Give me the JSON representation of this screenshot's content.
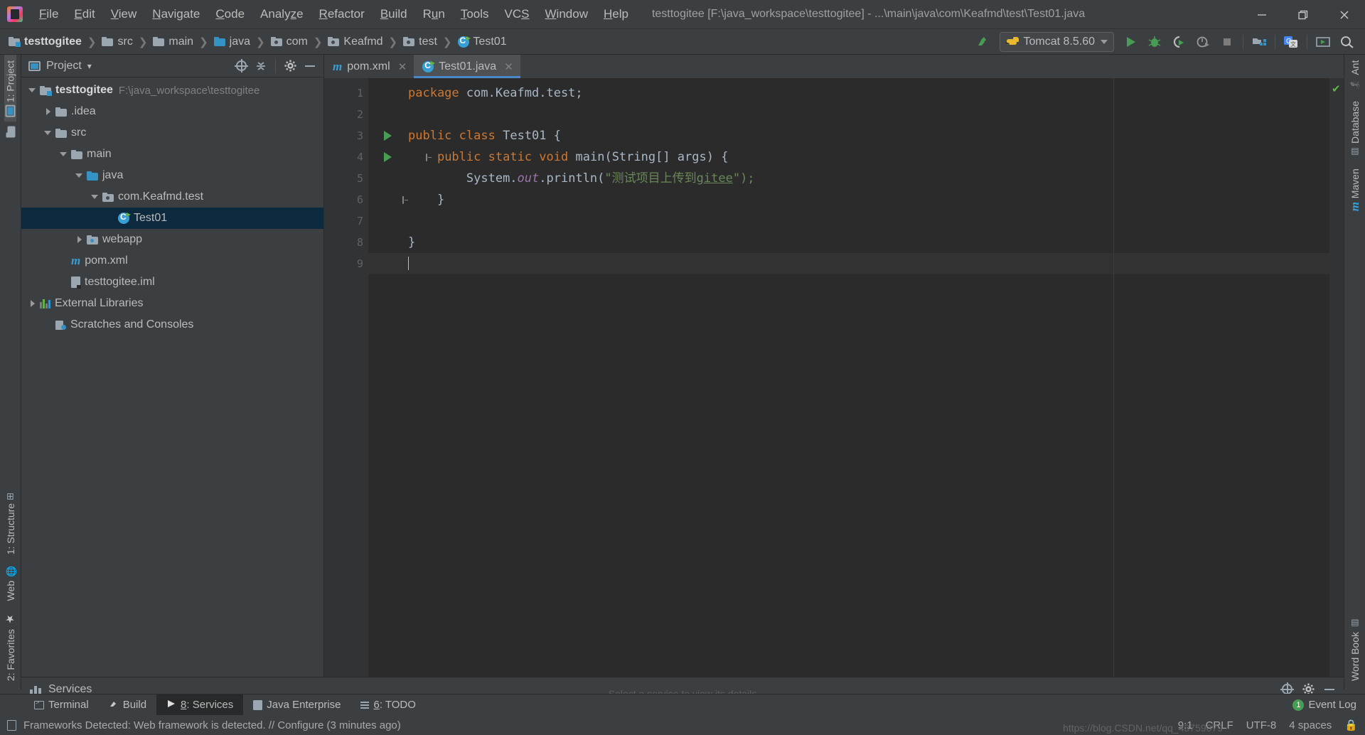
{
  "window": {
    "title": "testtogitee [F:\\java_workspace\\testtogitee] - ...\\main\\java\\com\\Keafmd\\test\\Test01.java",
    "minimize": "—",
    "maximize": "❐",
    "close": "✕"
  },
  "menu": [
    {
      "label": "File"
    },
    {
      "label": "Edit"
    },
    {
      "label": "View"
    },
    {
      "label": "Navigate"
    },
    {
      "label": "Code"
    },
    {
      "label": "Analyze"
    },
    {
      "label": "Refactor"
    },
    {
      "label": "Build"
    },
    {
      "label": "Run"
    },
    {
      "label": "Tools"
    },
    {
      "label": "VCS"
    },
    {
      "label": "Window"
    },
    {
      "label": "Help"
    }
  ],
  "breadcrumb": [
    {
      "label": "testtogitee",
      "icon": "project-folder-icon"
    },
    {
      "label": "src",
      "icon": "folder-icon"
    },
    {
      "label": "main",
      "icon": "folder-icon"
    },
    {
      "label": "java",
      "icon": "source-folder-icon"
    },
    {
      "label": "com",
      "icon": "package-icon"
    },
    {
      "label": "Keafmd",
      "icon": "package-icon"
    },
    {
      "label": "test",
      "icon": "package-icon"
    },
    {
      "label": "Test01",
      "icon": "java-class-icon"
    }
  ],
  "toolbar": {
    "build_label": "build-icon",
    "run_config": "Tomcat 8.5.60",
    "run_config_icon": "tomcat-icon",
    "actions": [
      "run-icon",
      "debug-icon",
      "run-coverage-icon",
      "profile-icon",
      "stop-icon",
      "project-structure-icon",
      "translate-icon",
      "open-in-browser-icon",
      "search-everywhere-icon"
    ]
  },
  "left_strip": [
    {
      "label": "1: Project",
      "active": true
    },
    {
      "label": "2: Favorites",
      "active": false
    },
    {
      "label": "Web",
      "active": false
    },
    {
      "label": "1: Structure",
      "active": false
    }
  ],
  "right_strip": [
    {
      "label": "Ant"
    },
    {
      "label": "Database"
    },
    {
      "label": "Maven"
    },
    {
      "label": "Word Book"
    }
  ],
  "project_panel": {
    "title": "Project",
    "title_caret": "▾",
    "tools": [
      "locate-icon",
      "collapse-all-icon",
      "settings-gear-icon",
      "hide-icon"
    ],
    "tree": [
      {
        "label": "testtogitee",
        "path": "F:\\java_workspace\\testtogitee",
        "depth": 0,
        "arrow": "down",
        "icon": "project-folder-icon",
        "bold": true,
        "selected": false
      },
      {
        "label": ".idea",
        "path": "",
        "depth": 1,
        "arrow": "right",
        "icon": "folder-icon",
        "bold": false,
        "selected": false
      },
      {
        "label": "src",
        "path": "",
        "depth": 1,
        "arrow": "down",
        "icon": "folder-icon",
        "bold": false,
        "selected": false
      },
      {
        "label": "main",
        "path": "",
        "depth": 2,
        "arrow": "down",
        "icon": "folder-icon",
        "bold": false,
        "selected": false
      },
      {
        "label": "java",
        "path": "",
        "depth": 3,
        "arrow": "down",
        "icon": "source-folder-icon",
        "bold": false,
        "selected": false
      },
      {
        "label": "com.Keafmd.test",
        "path": "",
        "depth": 4,
        "arrow": "down",
        "icon": "package-icon",
        "bold": false,
        "selected": false
      },
      {
        "label": "Test01",
        "path": "",
        "depth": 5,
        "arrow": "none",
        "icon": "java-class-icon",
        "bold": false,
        "selected": true
      },
      {
        "label": "webapp",
        "path": "",
        "depth": 3,
        "arrow": "right",
        "icon": "webapp-folder-icon",
        "bold": false,
        "selected": false
      },
      {
        "label": "pom.xml",
        "path": "",
        "depth": 2,
        "arrow": "none",
        "icon": "maven-icon",
        "bold": false,
        "selected": false
      },
      {
        "label": "testtogitee.iml",
        "path": "",
        "depth": 2,
        "arrow": "none",
        "icon": "iml-file-icon",
        "bold": false,
        "selected": false
      },
      {
        "label": "External Libraries",
        "path": "",
        "depth": 0,
        "arrow": "right",
        "icon": "libraries-icon",
        "bold": false,
        "selected": false
      },
      {
        "label": "Scratches and Consoles",
        "path": "",
        "depth": 0,
        "arrow": "none",
        "icon": "scratches-icon",
        "bold": false,
        "selected": false
      }
    ]
  },
  "editor": {
    "tabs": [
      {
        "label": "pom.xml",
        "icon": "maven-icon",
        "active": false,
        "close": "✕"
      },
      {
        "label": "Test01.java",
        "icon": "java-class-icon",
        "active": true,
        "close": "✕"
      }
    ],
    "line_numbers": [
      "1",
      "2",
      "3",
      "4",
      "5",
      "6",
      "7",
      "8",
      "9"
    ],
    "code": {
      "l1_kw": "package",
      "l1_rest": " com.Keafmd.test;",
      "l3_kw1": "public",
      "l3_kw2": "class",
      "l3_name": "Test01",
      "l3_brace": "{",
      "l4_kw1": "public",
      "l4_kw2": "static",
      "l4_kw3": "void",
      "l4_name": "main",
      "l4_params": "(String[] args) {",
      "l5_sys": "System.",
      "l5_out": "out",
      "l5_println": ".println(",
      "l5_str_open": "\"测试项目上传到",
      "l5_str_link": "gitee",
      "l5_str_close": "\");",
      "l6_brace": "}",
      "l8_brace": "}"
    }
  },
  "services_panel": {
    "title": "Services",
    "icon": "services-icon",
    "hint": "Select a service to view its details",
    "tools": [
      "add-icon",
      "settings-gear-icon",
      "hide-icon"
    ]
  },
  "tool_window_bar": {
    "items": [
      {
        "label": "Terminal",
        "icon": "terminal-icon",
        "active": false
      },
      {
        "label": "Build",
        "icon": "build-icon",
        "active": false
      },
      {
        "label": "8: Services",
        "icon": "services-run-icon",
        "active": true
      },
      {
        "label": "Java Enterprise",
        "icon": "java-enterprise-icon",
        "active": false
      },
      {
        "label": "6: TODO",
        "icon": "todo-icon",
        "active": false
      }
    ],
    "event_log": {
      "label": "Event Log",
      "badge": "1"
    }
  },
  "status_bar": {
    "message": "Frameworks Detected: Web framework is detected. // Configure (3 minutes ago)",
    "icon": "notification-icon",
    "caret_position": "9:1",
    "line_separator": "CRLF",
    "encoding": "UTF-8",
    "indent": "4 spaces",
    "lock": "🔒",
    "watermark": "https://blog.CSDN.net/qq_43759079"
  },
  "colors": {
    "bg": "#3c3f41",
    "editor_bg": "#2b2b2b",
    "accent": "#4a88c7",
    "selection": "#0d293e",
    "keyword": "#cc7832",
    "string": "#6a8759",
    "static_field": "#9876aa",
    "green_run": "#499c54"
  }
}
